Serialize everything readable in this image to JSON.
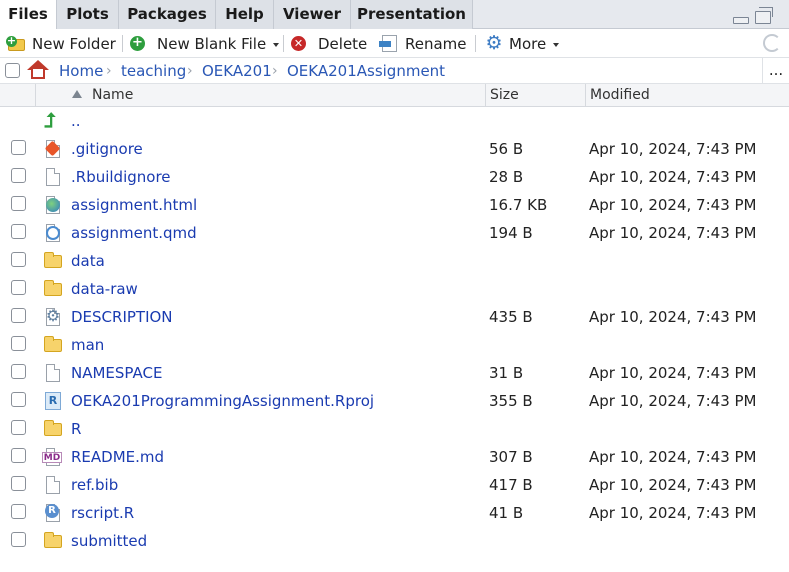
{
  "tabs": [
    {
      "label": "Files"
    },
    {
      "label": "Plots"
    },
    {
      "label": "Packages"
    },
    {
      "label": "Help"
    },
    {
      "label": "Viewer"
    },
    {
      "label": "Presentation"
    }
  ],
  "toolbar": {
    "new_folder": "New Folder",
    "new_blank_file": "New Blank File",
    "delete": "Delete",
    "rename": "Rename",
    "more": "More"
  },
  "breadcrumb": {
    "items": [
      "Home",
      "teaching",
      "OEKA201",
      "OEKA201Assignment"
    ],
    "more": "..."
  },
  "columns": {
    "name": "Name",
    "size": "Size",
    "modified": "Modified"
  },
  "parent": {
    "name": ".."
  },
  "files": [
    {
      "name": ".gitignore",
      "size": "56 B",
      "modified": "Apr 10, 2024, 7:43 PM",
      "icon": "git-file-icon"
    },
    {
      "name": ".Rbuildignore",
      "size": "28 B",
      "modified": "Apr 10, 2024, 7:43 PM",
      "icon": "text-file-icon"
    },
    {
      "name": "assignment.html",
      "size": "16.7 KB",
      "modified": "Apr 10, 2024, 7:43 PM",
      "icon": "html-file-icon"
    },
    {
      "name": "assignment.qmd",
      "size": "194 B",
      "modified": "Apr 10, 2024, 7:43 PM",
      "icon": "quarto-file-icon"
    },
    {
      "name": "data",
      "size": "",
      "modified": "",
      "icon": "folder-icon"
    },
    {
      "name": "data-raw",
      "size": "",
      "modified": "",
      "icon": "folder-icon"
    },
    {
      "name": "DESCRIPTION",
      "size": "435 B",
      "modified": "Apr 10, 2024, 7:43 PM",
      "icon": "description-file-icon"
    },
    {
      "name": "man",
      "size": "",
      "modified": "",
      "icon": "folder-icon"
    },
    {
      "name": "NAMESPACE",
      "size": "31 B",
      "modified": "Apr 10, 2024, 7:43 PM",
      "icon": "namespace-file-icon"
    },
    {
      "name": "OEKA201ProgrammingAssignment.Rproj",
      "size": "355 B",
      "modified": "Apr 10, 2024, 7:43 PM",
      "icon": "rproj-file-icon"
    },
    {
      "name": "R",
      "size": "",
      "modified": "",
      "icon": "folder-icon"
    },
    {
      "name": "README.md",
      "size": "307 B",
      "modified": "Apr 10, 2024, 7:43 PM",
      "icon": "markdown-file-icon"
    },
    {
      "name": "ref.bib",
      "size": "417 B",
      "modified": "Apr 10, 2024, 7:43 PM",
      "icon": "text-file-icon"
    },
    {
      "name": "rscript.R",
      "size": "41 B",
      "modified": "Apr 10, 2024, 7:43 PM",
      "icon": "r-script-file-icon"
    },
    {
      "name": "submitted",
      "size": "",
      "modified": "",
      "icon": "folder-icon"
    }
  ],
  "colors": {
    "link": "#1a3bb0",
    "accent": "#2a57b5",
    "folder": "#f7d36b"
  }
}
